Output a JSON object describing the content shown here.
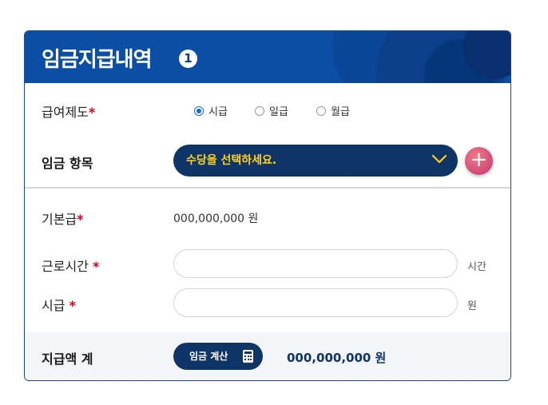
{
  "header": {
    "title": "임금지급내역",
    "step_badge": "1"
  },
  "pay_system": {
    "label": "급여제도",
    "required_mark": "*",
    "options": [
      {
        "label": "시급",
        "selected": true
      },
      {
        "label": "일급",
        "selected": false
      },
      {
        "label": "월급",
        "selected": false
      }
    ]
  },
  "wage_items": {
    "label": "임금 항목",
    "select_value": "수당을 선택하세요.",
    "add_icon": "plus-icon"
  },
  "base_pay": {
    "label": "기본급",
    "required_mark": "*",
    "value": "000,000,000 원"
  },
  "work_hours": {
    "label": "근로시간",
    "required_mark": "*",
    "value": "",
    "placeholder": "",
    "unit": "시간"
  },
  "hourly_wage": {
    "label": "시급",
    "required_mark": "*",
    "value": "",
    "placeholder": "",
    "unit": "원"
  },
  "total": {
    "label": "지급액 계",
    "button_label": "임금 계산",
    "button_icon": "calculator-icon",
    "value": "000,000,000 원"
  },
  "colors": {
    "header_bg": "#0b4ea5",
    "navy": "#0e3566",
    "select_text": "#ffd11a",
    "required": "#d0021b",
    "plus_button": "#d9476f"
  }
}
